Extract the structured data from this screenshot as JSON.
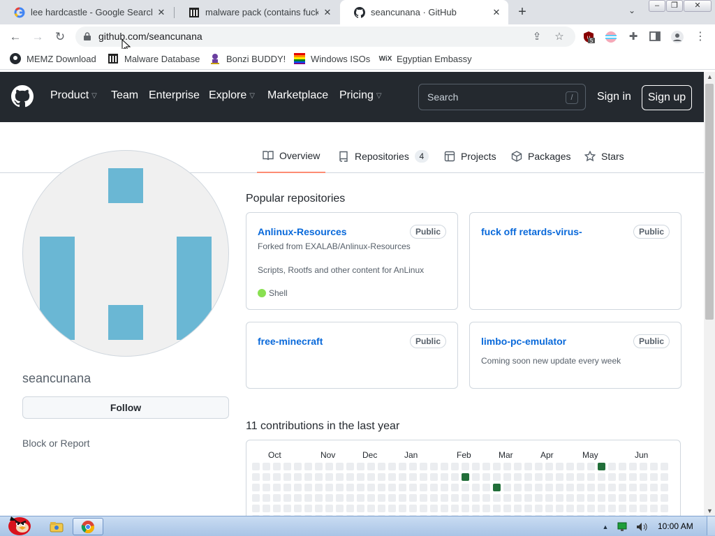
{
  "browser": {
    "tabs": [
      {
        "title": "lee hardcastle - Google Search",
        "icon": "google-icon"
      },
      {
        "title": "malware pack (contains fuck o",
        "icon": "building-icon"
      },
      {
        "title": "seancunana · GitHub",
        "icon": "github-icon",
        "active": true
      }
    ],
    "new_tab": "+",
    "url_host": "github.com/",
    "url_path": "seancunana",
    "extension_badge": "5",
    "bookmarks": [
      {
        "label": "MEMZ Download",
        "icon": "github-icon"
      },
      {
        "label": "Malware Database",
        "icon": "building-icon"
      },
      {
        "label": "Bonzi BUDDY!",
        "icon": "gorilla-icon"
      },
      {
        "label": "Windows ISOs",
        "icon": "windows-icon"
      },
      {
        "label": "Egyptian Embassy",
        "icon": "wix-icon",
        "icon_text": "WiX"
      }
    ]
  },
  "github": {
    "nav": [
      {
        "label": "Product",
        "dropdown": true
      },
      {
        "label": "Team",
        "dropdown": false
      },
      {
        "label": "Enterprise",
        "dropdown": false
      },
      {
        "label": "Explore",
        "dropdown": true
      },
      {
        "label": "Marketplace",
        "dropdown": false
      },
      {
        "label": "Pricing",
        "dropdown": true
      }
    ],
    "search_placeholder": "Search",
    "search_key": "/",
    "sign_in": "Sign in",
    "sign_up": "Sign up"
  },
  "profile": {
    "username": "seancunana",
    "follow": "Follow",
    "block_report": "Block or Report",
    "tabs": [
      {
        "label": "Overview",
        "icon": "book-icon",
        "active": true
      },
      {
        "label": "Repositories",
        "icon": "repo-icon",
        "count": "4"
      },
      {
        "label": "Projects",
        "icon": "table-icon"
      },
      {
        "label": "Packages",
        "icon": "package-icon"
      },
      {
        "label": "Stars",
        "icon": "star-icon"
      }
    ]
  },
  "popular": {
    "heading": "Popular repositories",
    "repos": [
      {
        "name": "Anlinux-Resources",
        "visibility": "Public",
        "forked_from": "Forked from EXALAB/Anlinux-Resources",
        "description": "Scripts, Rootfs and other content for AnLinux",
        "language": "Shell",
        "language_color": "#89e051"
      },
      {
        "name": "fuck off retards-virus-",
        "visibility": "Public"
      },
      {
        "name": "free-minecraft",
        "visibility": "Public"
      },
      {
        "name": "limbo-pc-emulator",
        "visibility": "Public",
        "description": "Coming soon new update every week"
      }
    ]
  },
  "contributions": {
    "heading": "11 contributions in the last year",
    "months": [
      "Oct",
      "Nov",
      "Dec",
      "Jan",
      "Feb",
      "Mar",
      "Apr",
      "May",
      "Jun"
    ],
    "weeks_visible": 40,
    "filled": [
      {
        "week": 20,
        "day": 1
      },
      {
        "week": 23,
        "day": 2
      },
      {
        "week": 33,
        "day": 0
      }
    ],
    "empty_color": "#ebedf0",
    "filled_color": "#216e39"
  },
  "taskbar": {
    "clock": "10:00 AM"
  },
  "colors": {
    "header_bg": "#24292f",
    "link": "#0969da",
    "active_tab_underline": "#fd8c73",
    "avatar_block": "#6ab7d4"
  }
}
